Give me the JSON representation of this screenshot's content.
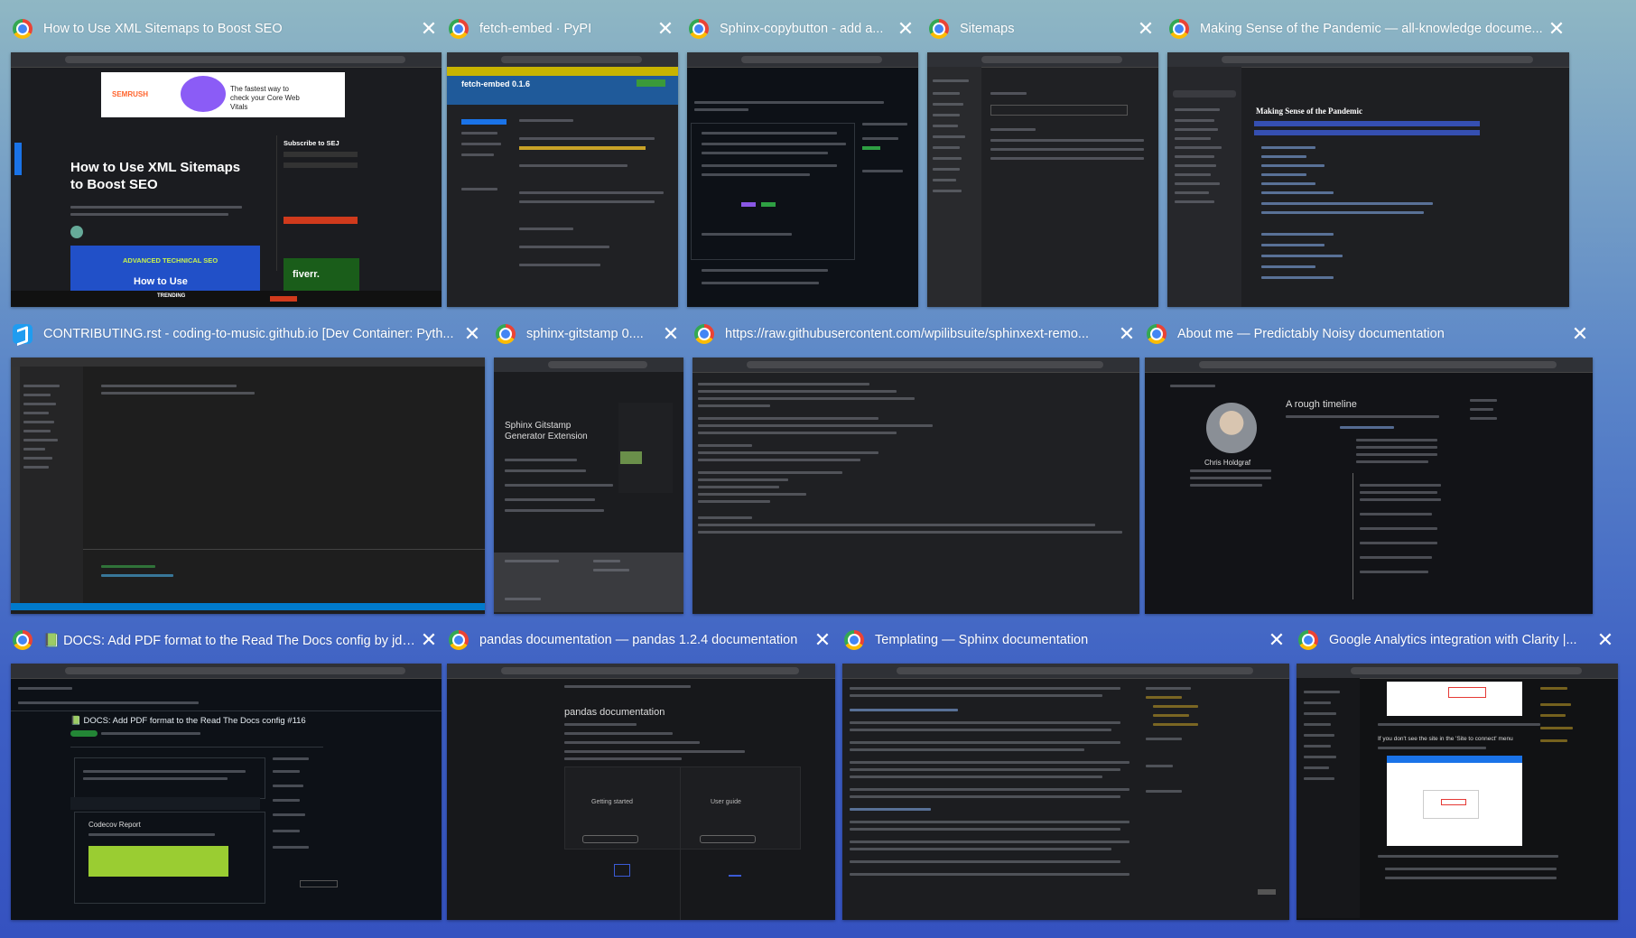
{
  "windows": [
    {
      "title": "How to Use XML Sitemaps to Boost SEO",
      "icon": "chrome-icon"
    },
    {
      "title": "fetch-embed · PyPI",
      "icon": "chrome-icon"
    },
    {
      "title": "Sphinx-copybutton - add a...",
      "icon": "chrome-icon"
    },
    {
      "title": "Sitemaps",
      "icon": "chrome-icon"
    },
    {
      "title": "Making Sense of the Pandemic — all-knowledge docume...",
      "icon": "chrome-icon"
    },
    {
      "title": "CONTRIBUTING.rst - coding-to-music.github.io [Dev Container: Pyth...",
      "icon": "vscode-icon"
    },
    {
      "title": "sphinx-gitstamp 0....",
      "icon": "chrome-icon"
    },
    {
      "title": "https://raw.githubusercontent.com/wpilibsuite/sphinxext-remo...",
      "icon": "chrome-icon"
    },
    {
      "title": "About me — Predictably Noisy documentation",
      "icon": "chrome-icon"
    },
    {
      "title": "📗 DOCS: Add PDF format to the Read The Docs config by jdil...",
      "icon": "chrome-icon"
    },
    {
      "title": "pandas documentation — pandas 1.2.4 documentation",
      "icon": "chrome-icon"
    },
    {
      "title": "Templating — Sphinx documentation",
      "icon": "chrome-icon"
    },
    {
      "title": "Google Analytics integration with Clarity |...",
      "icon": "chrome-icon"
    }
  ],
  "close_glyph": "✕",
  "previews": {
    "semrush_headline": "How to Use XML Sitemaps to Boost SEO",
    "semrush_logo": "SEMRUSH",
    "semrush_ad": "The fastest way to check your Core Web Vitals",
    "semrush_subscribe": "Subscribe to SEJ",
    "semrush_advanced": "ADVANCED TECHNICAL SEO",
    "semrush_howto": "How to Use",
    "semrush_fiverr": "fiverr.",
    "semrush_trending": "TRENDING",
    "pypi_title": "fetch-embed 0.1.6",
    "mak_heading": "Making Sense of the Pandemic",
    "gitstamp_heading": "Sphinx Gitstamp Generator Extension",
    "about_heading": "A rough timeline",
    "about_name": "Chris Holdgraf",
    "pr_heading": "📗 DOCS: Add PDF format to the Read The Docs config #116",
    "codecov": "Codecov Report",
    "pandas_heading": "pandas documentation",
    "pandas_card1": "Getting started",
    "pandas_card2": "User guide",
    "clarity_heading": "If you don't see the site in the 'Site to connect' menu"
  },
  "colors": {
    "accent_blue": "#1a73e8",
    "codecov_green": "#9acd32",
    "pypi_blue": "#1f5a9a",
    "vscode_blue": "#007acc",
    "semrush_orange": "#ff642d"
  }
}
